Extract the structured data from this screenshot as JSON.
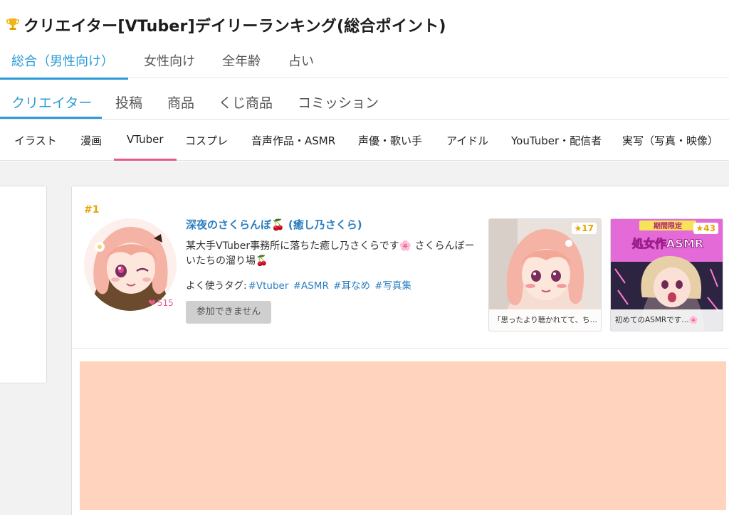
{
  "header": {
    "title": "クリエイター[VTuber]デイリーランキング(総合ポイント)",
    "trophy_icon": "trophy-icon"
  },
  "tabs_audience": [
    {
      "label": "総合（男性向け）",
      "active": true
    },
    {
      "label": "女性向け",
      "active": false
    },
    {
      "label": "全年齢",
      "active": false
    },
    {
      "label": "占い",
      "active": false
    }
  ],
  "tabs_type": [
    {
      "label": "クリエイター",
      "active": true
    },
    {
      "label": "投稿",
      "active": false
    },
    {
      "label": "商品",
      "active": false
    },
    {
      "label": "くじ商品",
      "active": false
    },
    {
      "label": "コミッション",
      "active": false
    }
  ],
  "tabs_category": [
    {
      "label": "イラスト",
      "active": false
    },
    {
      "label": "漫画",
      "active": false
    },
    {
      "label": "VTuber",
      "active": true
    },
    {
      "label": "コスプレ",
      "active": false
    },
    {
      "label": "音声作品・ASMR",
      "active": false
    },
    {
      "label": "声優・歌い手",
      "active": false
    },
    {
      "label": "アイドル",
      "active": false
    },
    {
      "label": "YouTuber・配信者",
      "active": false
    },
    {
      "label": "実写（写真・映像）",
      "active": false
    }
  ],
  "ranking": {
    "rank": "#1",
    "creator_name": "深夜のさくらんぼ🍒 (癒し乃さくら)",
    "description": "某大手VTuber事務所に落ちた癒し乃さくらです🌸 さくらんぼーいたちの溜り場🍒",
    "tags_label": "よく使うタグ:",
    "tags": [
      "#Vtuber",
      "#ASMR",
      "#耳なめ",
      "#写真集"
    ],
    "likes": "515",
    "heart_icon": "heart-icon",
    "join_button": "参加できません",
    "thumbnails": [
      {
        "stars": "★17",
        "caption": "「思ったより聴かれてて、ち…"
      },
      {
        "stars": "★43",
        "caption": "初めてのASMRです…🌸",
        "banner": "期間限定",
        "overlay_title": "処女作ASMR"
      }
    ]
  },
  "colors": {
    "accent_blue": "#2a9bd7",
    "accent_pink": "#e65a8d",
    "rank_gold": "#e8a400",
    "ad_block": "#ffd3be"
  }
}
